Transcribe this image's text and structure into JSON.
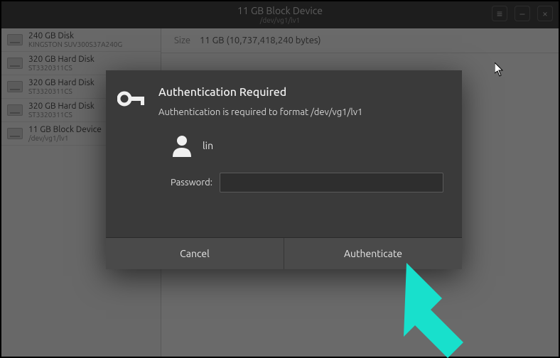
{
  "header": {
    "title": "11 GB Block Device",
    "subtitle": "/dev/vg1/lv1"
  },
  "sidebar": {
    "devices": [
      {
        "name": "240 GB Disk",
        "sub": "KINGSTON SUV300S37A240G"
      },
      {
        "name": "320 GB Hard Disk",
        "sub": "ST3320311CS"
      },
      {
        "name": "320 GB Hard Disk",
        "sub": "ST3320311CS"
      },
      {
        "name": "320 GB Hard Disk",
        "sub": "ST3320311CS"
      },
      {
        "name": "11 GB Block Device",
        "sub": "/dev/vg1/lv1"
      }
    ]
  },
  "content": {
    "size_label": "Size",
    "size_value": "11 GB (10,737,418,240 bytes)"
  },
  "dialog": {
    "title": "Authentication Required",
    "message": "Authentication is required to format /dev/vg1/lv1",
    "username": "lin",
    "password_label": "Password:",
    "password_value": "",
    "buttons": {
      "cancel": "Cancel",
      "authenticate": "Authenticate"
    }
  }
}
